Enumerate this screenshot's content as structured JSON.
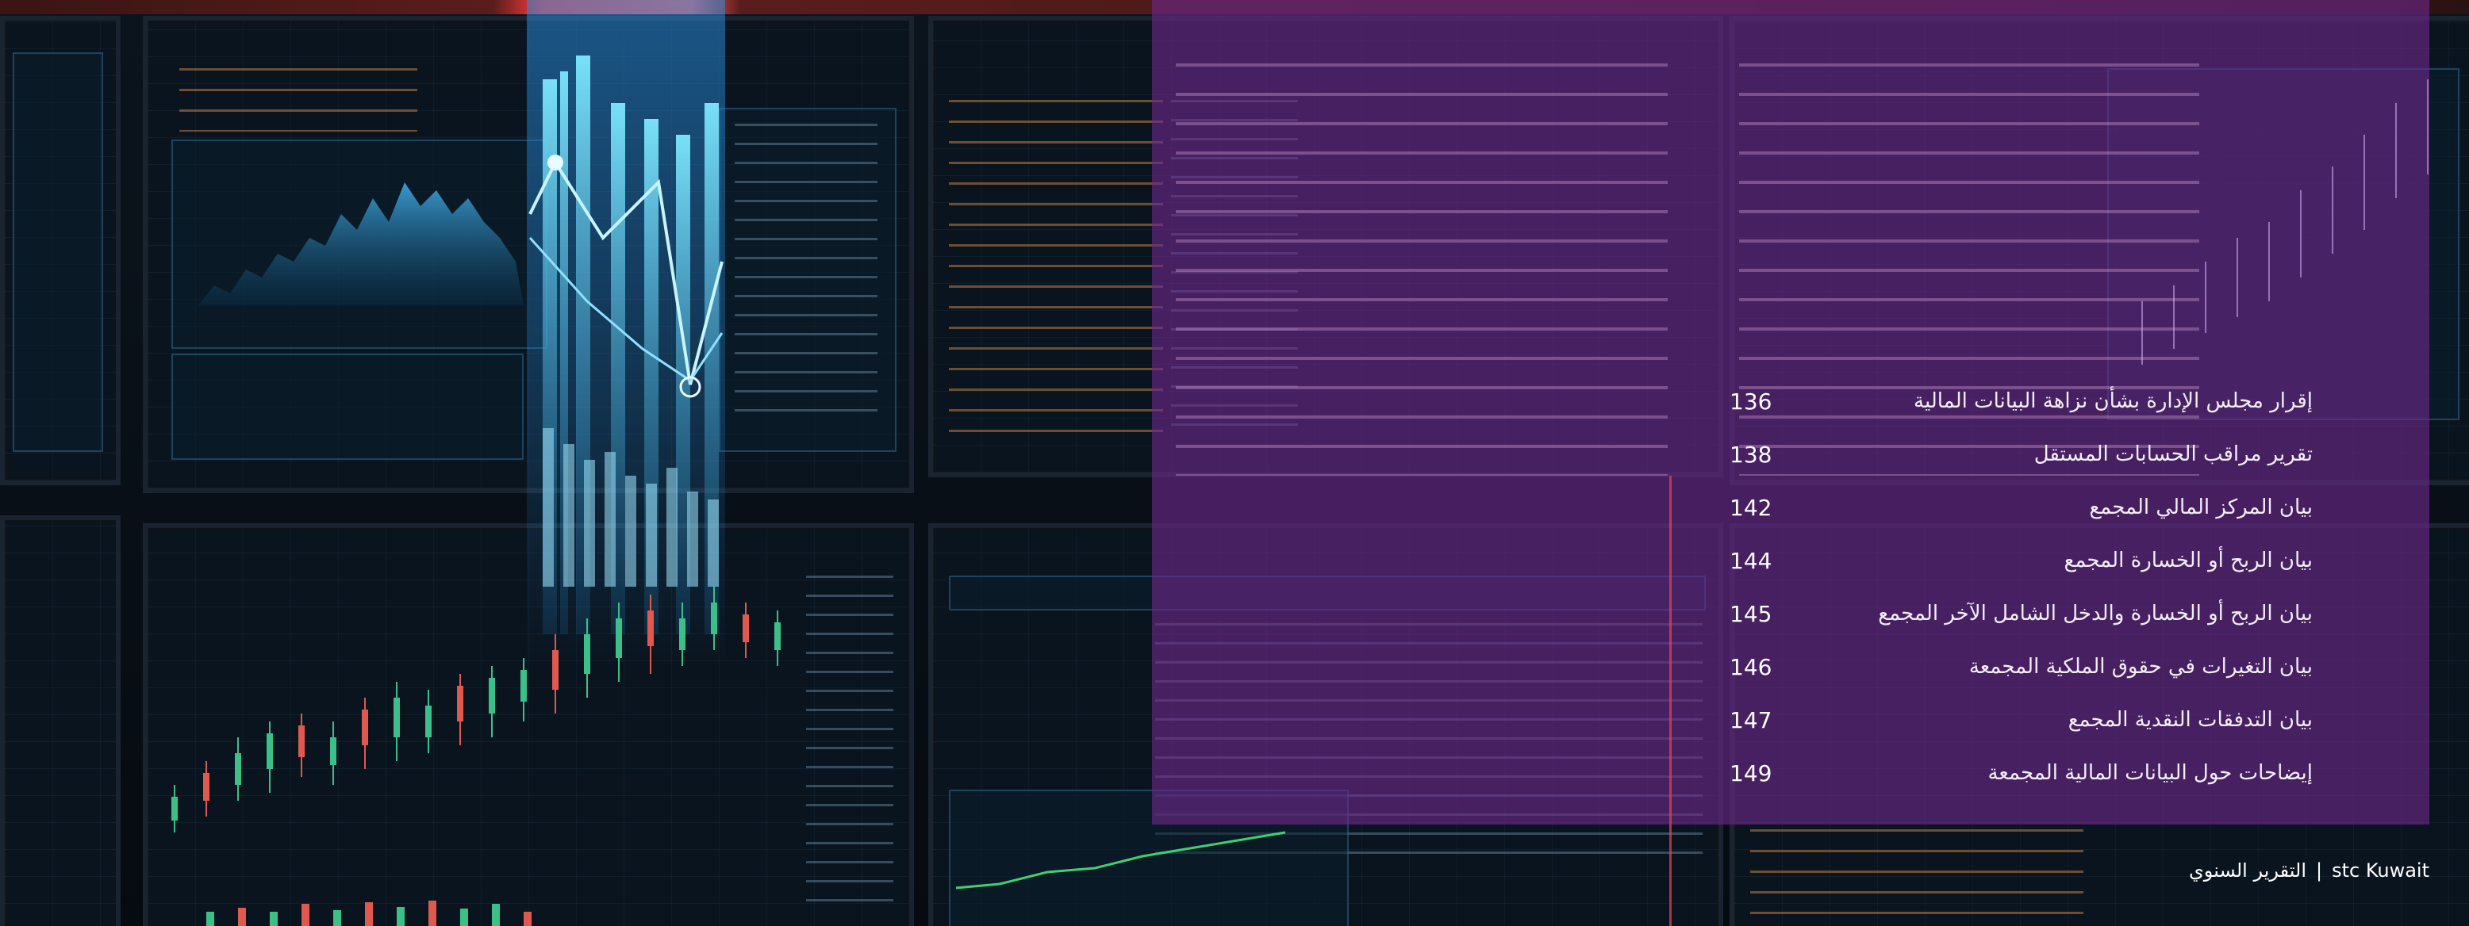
{
  "toc": {
    "items": [
      {
        "title": "إقرار مجلس الإدارة بشأن نزاهة البيانات المالية",
        "page": "136"
      },
      {
        "title": "تقرير مراقب الحسابات المستقل",
        "page": "138"
      },
      {
        "title": "بيان المركز المالي المجمع",
        "page": "142"
      },
      {
        "title": "بيان الربح أو الخسارة المجمع",
        "page": "144"
      },
      {
        "title": "بيان الربح أو الخسارة والدخل الشامل الآخر المجمع",
        "page": "145"
      },
      {
        "title": "بيان التغيرات في حقوق الملكية المجمعة",
        "page": "146"
      },
      {
        "title": "بيان التدفقات النقدية المجمع",
        "page": "147"
      },
      {
        "title": "إيضاحات حول البيانات المالية المجمعة",
        "page": "149"
      }
    ]
  },
  "footer": {
    "report": "التقرير السنوي",
    "separator": "|",
    "company": "stc Kuwait"
  },
  "colors": {
    "overlay": "#6e288c",
    "accent_cyan": "#3fc8ff",
    "text": "#ffffff"
  }
}
